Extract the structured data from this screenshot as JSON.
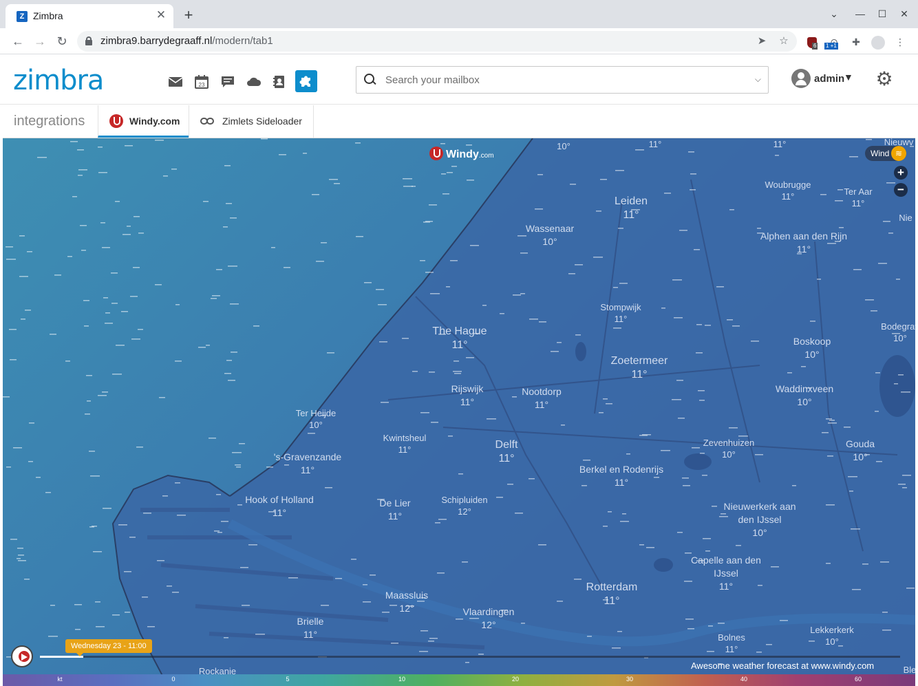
{
  "browser": {
    "tab_title": "Zimbra",
    "favicon_letter": "Z",
    "url_host": "zimbra9.barrydegraaff.nl",
    "url_path": "/modern/tab1",
    "ext_badge_1": "6",
    "ext_badge_2": "1 +1"
  },
  "header": {
    "logo": "zimbra",
    "apps": [
      "mail-icon",
      "calendar-icon",
      "chat-icon",
      "cloud-icon",
      "contacts-icon",
      "integrations-icon"
    ],
    "calendar_day": "23",
    "search_placeholder": "Search your mailbox",
    "username": "admin"
  },
  "subbar": {
    "title": "integrations",
    "tabs": [
      {
        "label": "Windy.com",
        "active": true
      },
      {
        "label": "Zimlets Sideloader",
        "active": false
      }
    ]
  },
  "map": {
    "logo": "Windy",
    "logo_suffix": ".com",
    "layer": "Wind",
    "cities": [
      {
        "name": "10°",
        "temp": ""
      },
      {
        "name": "11°",
        "temp": ""
      },
      {
        "name": "11°",
        "temp": ""
      },
      {
        "name": "Nieuwv",
        "temp": ""
      },
      {
        "name": "Nie",
        "temp": ""
      },
      {
        "name": "Leiden",
        "temp": "11°"
      },
      {
        "name": "Woubrugge",
        "temp": "11°"
      },
      {
        "name": "Ter Aar",
        "temp": "11°"
      },
      {
        "name": "Wassenaar",
        "temp": "10°"
      },
      {
        "name": "Alphen aan den Rijn",
        "temp": "11°"
      },
      {
        "name": "Stompwijk",
        "temp": "11°"
      },
      {
        "name": "Bodegrav",
        "temp": "10°"
      },
      {
        "name": "The Hague",
        "temp": "11°"
      },
      {
        "name": "Boskoop",
        "temp": "10°"
      },
      {
        "name": "Zoetermeer",
        "temp": "11°"
      },
      {
        "name": "Rijswijk",
        "temp": "11°"
      },
      {
        "name": "Nootdorp",
        "temp": "11°"
      },
      {
        "name": "Waddinxveen",
        "temp": "10°"
      },
      {
        "name": "Ter Heijde",
        "temp": "10°"
      },
      {
        "name": "Kwintsheul",
        "temp": "11°"
      },
      {
        "name": "Delft",
        "temp": "11°"
      },
      {
        "name": "Zevenhuizen",
        "temp": "10°"
      },
      {
        "name": "Gouda",
        "temp": "10°"
      },
      {
        "name": "'s-Gravenzande",
        "temp": "11°"
      },
      {
        "name": "Berkel en Rodenrijs",
        "temp": "11°"
      },
      {
        "name": "Hook of Holland",
        "temp": "11°"
      },
      {
        "name": "De Lier",
        "temp": "11°"
      },
      {
        "name": "Schipluiden",
        "temp": "12°"
      },
      {
        "name": "Nieuwerkerk aan den IJssel",
        "temp": "10°"
      },
      {
        "name": "Capelle aan den IJssel",
        "temp": "11°"
      },
      {
        "name": "Rotterdam",
        "temp": "11°"
      },
      {
        "name": "Maassluis",
        "temp": "12°"
      },
      {
        "name": "Vlaardingen",
        "temp": "12°"
      },
      {
        "name": "Brielle",
        "temp": "11°"
      },
      {
        "name": "Bolnes",
        "temp": "11°"
      },
      {
        "name": "Lekkerkerk",
        "temp": "10°"
      },
      {
        "name": "Rockanje",
        "temp": ""
      },
      {
        "name": "Ble",
        "temp": ""
      }
    ],
    "timestamp": "Wednesday 23 - 11:00",
    "timeline_progress": 0.05,
    "credit": "Awesome weather forecast at www.windy.com",
    "scale_unit": "kt",
    "scale_values": [
      "0",
      "5",
      "10",
      "20",
      "30",
      "40",
      "60"
    ]
  }
}
